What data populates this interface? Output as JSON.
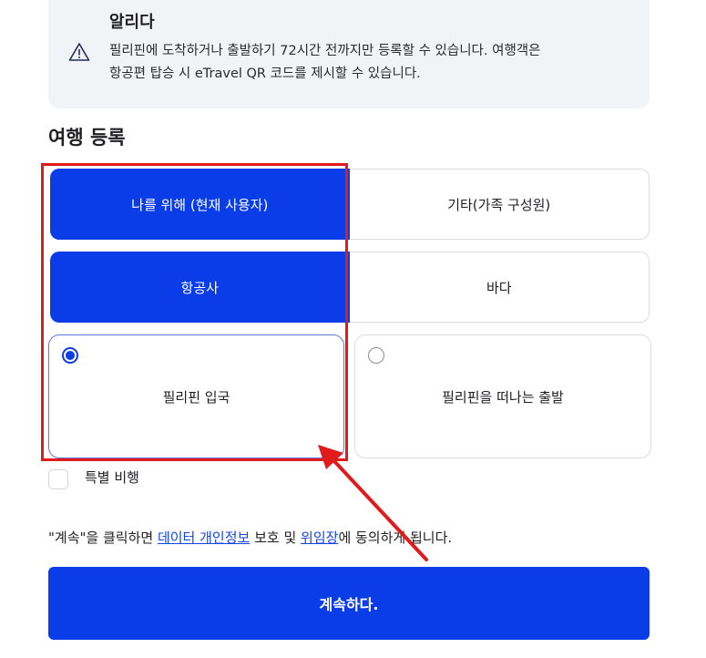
{
  "notice": {
    "title": "알리다",
    "icon": "warning-icon",
    "line1": "필리핀에 도착하거나 출발하기 72시간 전까지만 등록할 수 있습니다. 여행객은",
    "line2": "항공편 탑승 시 eTravel QR 코드를 제시할 수 있습니다."
  },
  "section_title": "여행 등록",
  "traveler_toggle": {
    "self": "나를 위해 (현재 사용자)",
    "other": "기타(가족 구성원)",
    "selected": "self"
  },
  "mode_toggle": {
    "air": "항공사",
    "sea": "바다",
    "selected": "air"
  },
  "direction": {
    "arrival": "필리핀 입국",
    "departure": "필리핀을 떠나는 출발",
    "selected": "arrival"
  },
  "special_flight": {
    "label": "특별 비행",
    "checked": false
  },
  "consent": {
    "prefix": "\"계속\"을 클릭하면 ",
    "link1": "데이터 개인정보",
    "middle": " 보호 및 ",
    "link2": "위임장",
    "suffix": "에 동의하게 됩니다."
  },
  "continue_button": "계속하다.",
  "colors": {
    "primary": "#0a3ce8",
    "annotation": "#e01b1b",
    "notice_bg": "#f2f3f6"
  }
}
